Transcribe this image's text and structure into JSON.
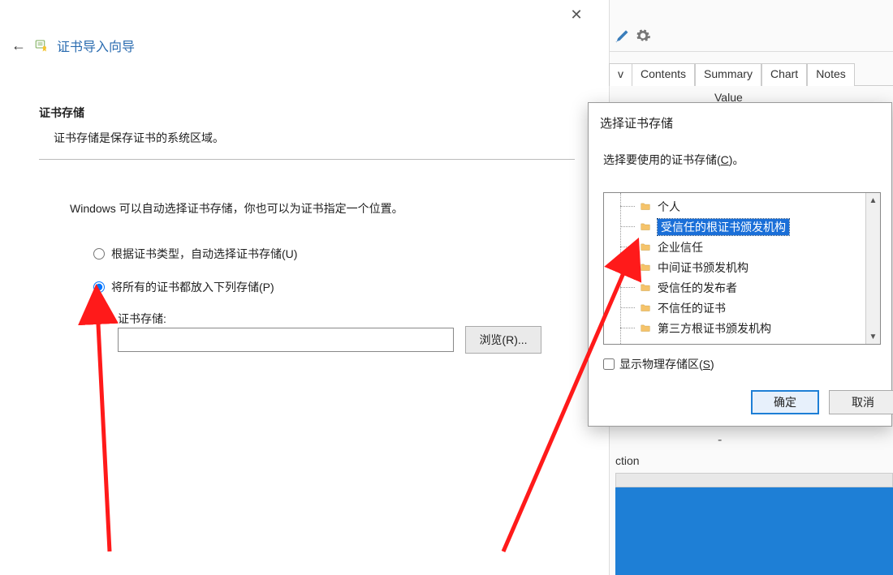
{
  "wizard": {
    "title": "证书导入向导",
    "close_glyph": "✕",
    "back_glyph": "←",
    "section_heading": "证书存储",
    "section_desc": "证书存储是保存证书的系统区域。",
    "auto_text": "Windows 可以自动选择证书存储，你也可以为证书指定一个位置。",
    "radio_auto_label": "根据证书类型，自动选择证书存储(U)",
    "radio_manual_label": "将所有的证书都放入下列存储(P)",
    "store_label": "证书存储:",
    "store_value": "",
    "browse_label": "浏览(R)..."
  },
  "bg": {
    "tab_prefix": "v",
    "tabs": [
      "Contents",
      "Summary",
      "Chart",
      "Notes"
    ],
    "col_value": "Value",
    "dash": "-",
    "ction": "ction"
  },
  "dlg": {
    "title": "选择证书存储",
    "instruction_pre": "选择要使用的证书存储(",
    "instruction_u": "C",
    "instruction_post": ")。",
    "items": [
      {
        "label": "个人",
        "selected": false
      },
      {
        "label": "受信任的根证书颁发机构",
        "selected": true
      },
      {
        "label": "企业信任",
        "selected": false
      },
      {
        "label": "中间证书颁发机构",
        "selected": false
      },
      {
        "label": "受信任的发布者",
        "selected": false
      },
      {
        "label": "不信任的证书",
        "selected": false
      },
      {
        "label": "第三方根证书颁发机构",
        "selected": false
      }
    ],
    "show_physical_pre": "显示物理存储区(",
    "show_physical_u": "S",
    "show_physical_post": ")",
    "ok": "确定",
    "cancel": "取消"
  },
  "colors": {
    "accent": "#1e7fd6",
    "annotation": "#ff1a1a"
  }
}
